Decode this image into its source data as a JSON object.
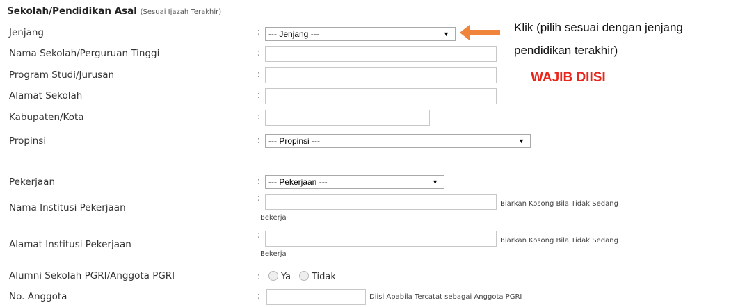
{
  "section": {
    "title": "Sekolah/Pendidikan Asal",
    "subtitle": "(Sesuai Ijazah Terakhir)"
  },
  "separator": ":",
  "fields": {
    "jenjang": {
      "label": "Jenjang",
      "selected": "--- Jenjang ---"
    },
    "nama_sekolah": {
      "label": "Nama Sekolah/Perguruan Tinggi",
      "value": ""
    },
    "program_studi": {
      "label": "Program Studi/Jurusan",
      "value": ""
    },
    "alamat_sekolah": {
      "label": "Alamat Sekolah",
      "value": ""
    },
    "kabupaten": {
      "label": "Kabupaten/Kota",
      "value": ""
    },
    "propinsi": {
      "label": "Propinsi",
      "selected": "--- Propinsi ---"
    },
    "pekerjaan": {
      "label": "Pekerjaan",
      "selected": "--- Pekerjaan ---"
    },
    "nama_institusi": {
      "label": "Nama Institusi Pekerjaan",
      "value": "",
      "hint_line1": "Biarkan Kosong Bila Tidak Sedang",
      "hint_line2": "Bekerja"
    },
    "alamat_institusi": {
      "label": "Alamat Institusi Pekerjaan",
      "value": "",
      "hint_line1": "Biarkan Kosong Bila Tidak Sedang",
      "hint_line2": "Bekerja"
    },
    "alumni": {
      "label": "Alumni Sekolah PGRI/Anggota PGRI",
      "option_yes": "Ya",
      "option_no": "Tidak"
    },
    "no_anggota": {
      "label": "No. Anggota",
      "value": "",
      "hint": "Diisi Apabila Tercatat sebagai Anggota PGRI"
    }
  },
  "annotation": {
    "callout_line1": "Klik (pilih sesuai dengan jenjang",
    "callout_line2": "pendidikan terakhir)",
    "required": "WAJIB DIISI",
    "arrow_color": "#f0843a",
    "required_color": "#e8261c"
  },
  "icons": {
    "select_caret": "▼",
    "arrow": "arrow-left-icon"
  }
}
